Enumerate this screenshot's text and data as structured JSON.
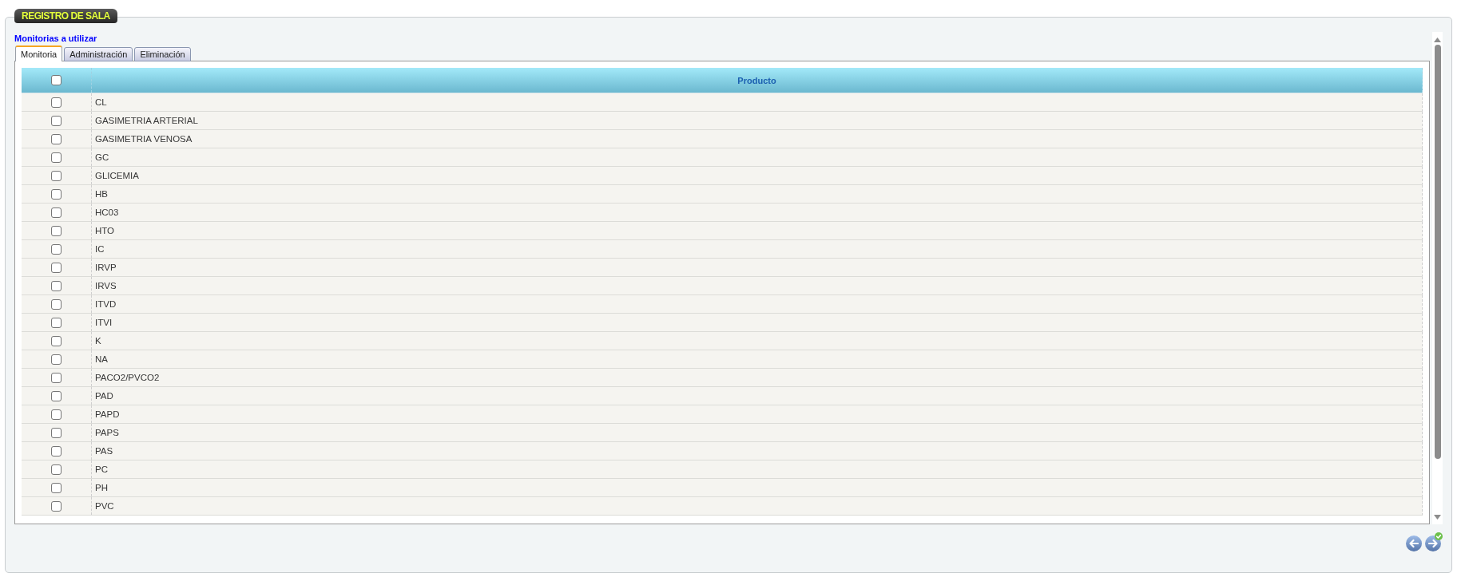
{
  "section": {
    "title": "REGISTRO DE SALA",
    "subtitle": "Monitorias a utilizar"
  },
  "tabs": [
    {
      "label": "Monitoria",
      "selected": true
    },
    {
      "label": "Administración",
      "selected": false
    },
    {
      "label": "Eliminación",
      "selected": false
    }
  ],
  "table": {
    "columns": [
      {
        "kind": "checkbox",
        "checked": false
      },
      {
        "kind": "text",
        "label": "Producto"
      }
    ],
    "rows": [
      {
        "checked": false,
        "label": "CL"
      },
      {
        "checked": false,
        "label": "GASIMETRIA ARTERIAL"
      },
      {
        "checked": false,
        "label": "GASIMETRIA VENOSA"
      },
      {
        "checked": false,
        "label": "GC"
      },
      {
        "checked": false,
        "label": "GLICEMIA"
      },
      {
        "checked": false,
        "label": "HB"
      },
      {
        "checked": false,
        "label": "HC03"
      },
      {
        "checked": false,
        "label": "HTO"
      },
      {
        "checked": false,
        "label": "IC"
      },
      {
        "checked": false,
        "label": "IRVP"
      },
      {
        "checked": false,
        "label": "IRVS"
      },
      {
        "checked": false,
        "label": "ITVD"
      },
      {
        "checked": false,
        "label": "ITVI"
      },
      {
        "checked": false,
        "label": "K"
      },
      {
        "checked": false,
        "label": "NA"
      },
      {
        "checked": false,
        "label": "PACO2/PVCO2"
      },
      {
        "checked": false,
        "label": "PAD"
      },
      {
        "checked": false,
        "label": "PAPD"
      },
      {
        "checked": false,
        "label": "PAPS"
      },
      {
        "checked": false,
        "label": "PAS"
      },
      {
        "checked": false,
        "label": "PC"
      },
      {
        "checked": false,
        "label": "PH"
      },
      {
        "checked": false,
        "label": "PVC"
      }
    ]
  },
  "footer": {
    "buttons": [
      {
        "kind": "back"
      },
      {
        "kind": "forward"
      }
    ]
  }
}
